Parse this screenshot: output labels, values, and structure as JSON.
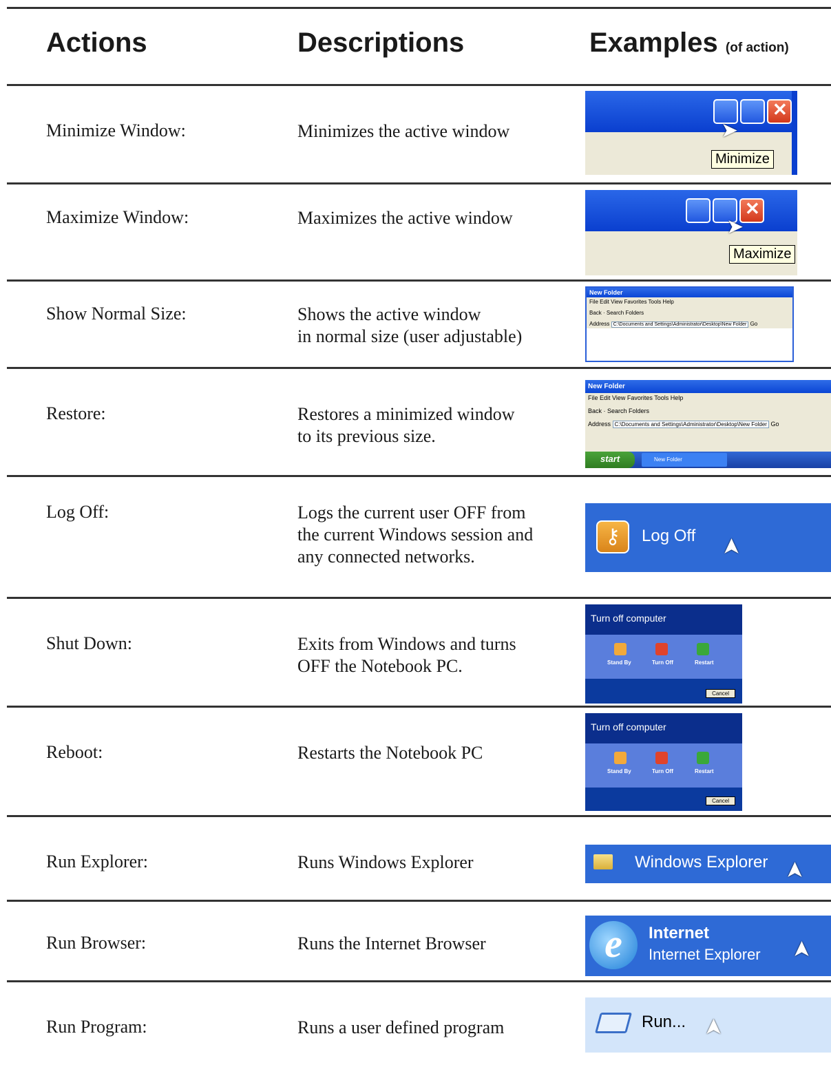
{
  "headers": {
    "actions": "Actions",
    "descriptions": "Descriptions",
    "examples": "Examples",
    "examples_note": "(of action)"
  },
  "rows": [
    {
      "action": "Minimize Window:",
      "description": [
        "Minimizes the active window"
      ]
    },
    {
      "action": "Maximize Window:",
      "description": [
        "Maximizes the active window"
      ]
    },
    {
      "action": "Show Normal Size:",
      "description": [
        "Shows the active window",
        "in normal size (user adjustable)"
      ]
    },
    {
      "action": "Restore:",
      "description": [
        "Restores a minimized window",
        "to its previous size."
      ]
    },
    {
      "action": "Log Off:",
      "description": [
        "Logs the current user OFF from",
        "the current Windows session and",
        "any connected networks."
      ]
    },
    {
      "action": "Shut Down:",
      "description": [
        "Exits from Windows and turns",
        "OFF the Notebook PC."
      ]
    },
    {
      "action": "Reboot:",
      "description": [
        "Restarts the Notebook PC"
      ]
    },
    {
      "action": "Run Explorer:",
      "description": [
        "Runs Windows Explorer"
      ]
    },
    {
      "action": "Run Browser:",
      "description": [
        "Runs the Internet Browser"
      ]
    },
    {
      "action": "Run Program:",
      "description": [
        "Runs a user defined program"
      ]
    }
  ],
  "examples": {
    "minimize_tooltip": "Minimize",
    "maximize_tooltip": "Maximize",
    "window_title": "New Folder",
    "menu_items": "File   Edit   View   Favorites   Tools   Help",
    "toolbar": "Back  ·  Search   Folders",
    "address_label": "Address",
    "address_path": "C:\\Documents and Settings\\Administrator\\Desktop\\New Folder",
    "go_label": "Go",
    "start_label": "start",
    "taskbar_item": "New Folder",
    "logoff_label": "Log Off",
    "turnoff_title": "Turn off computer",
    "stand_by": "Stand By",
    "turn_off": "Turn Off",
    "restart": "Restart",
    "cancel": "Cancel",
    "explorer_label": "Windows Explorer",
    "internet_title": "Internet",
    "internet_sub": "Internet Explorer",
    "run_label": "Run..."
  }
}
